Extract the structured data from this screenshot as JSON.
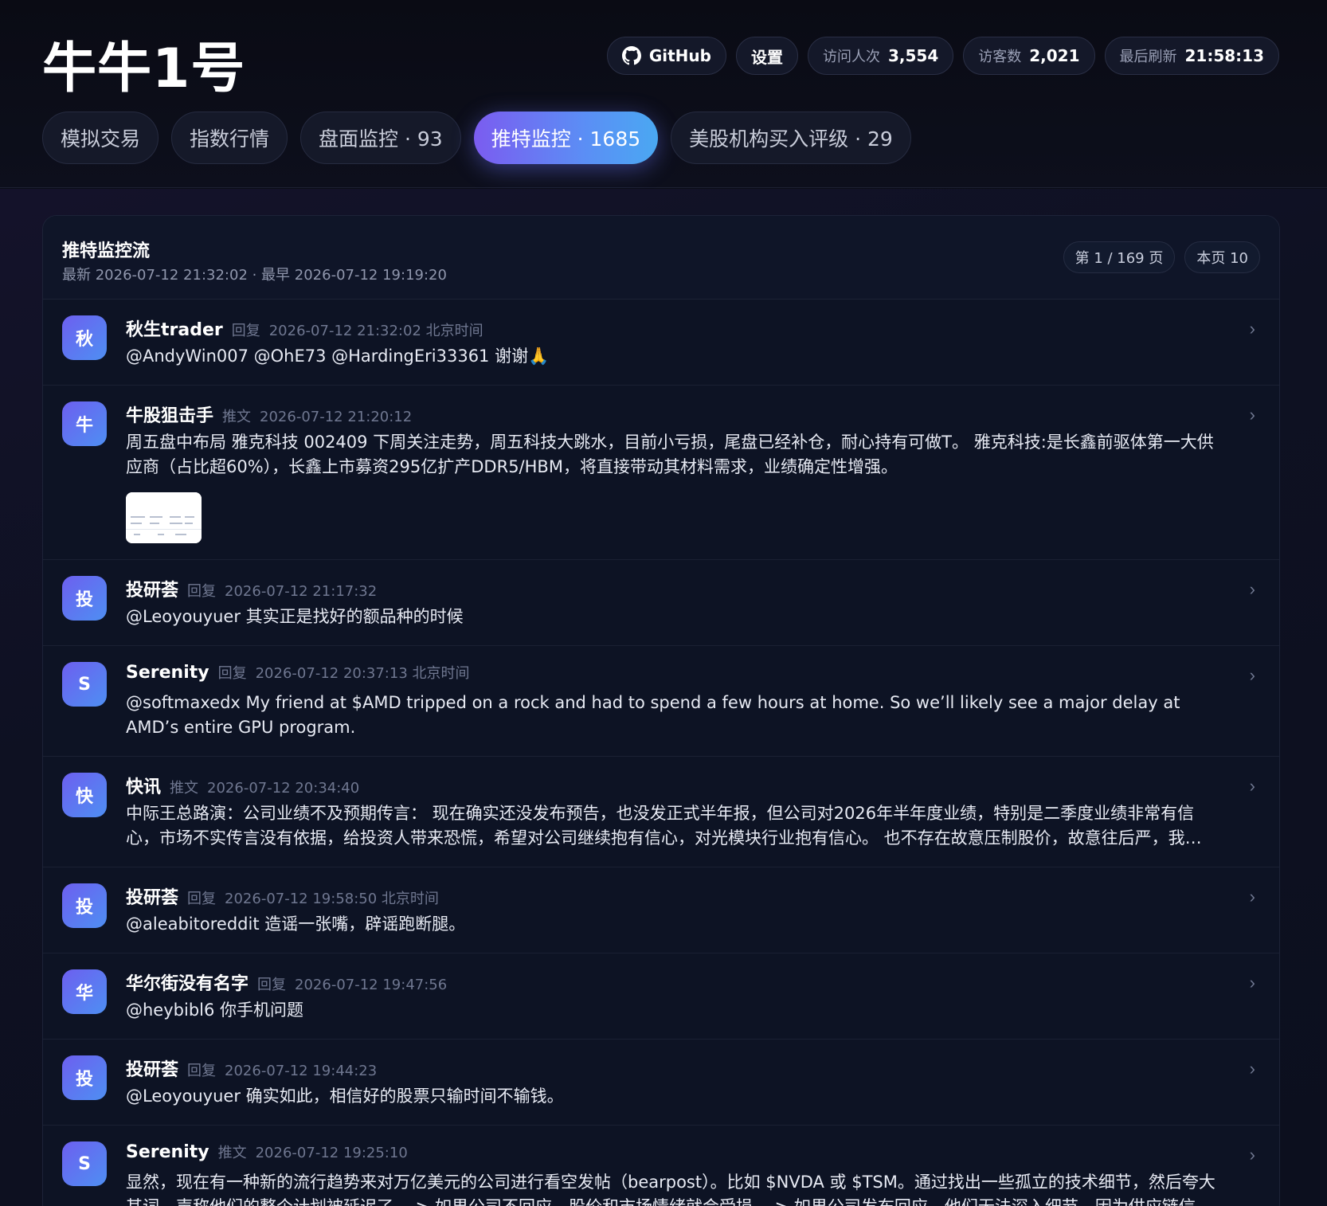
{
  "app": {
    "title": "牛牛1号"
  },
  "header": {
    "github_label": "GitHub",
    "settings_label": "设置",
    "visits_label": "访问人次",
    "visits_value": "3,554",
    "visitors_label": "访客数",
    "visitors_value": "2,021",
    "refresh_label": "最后刷新",
    "refresh_value": "21:58:13"
  },
  "tabs": [
    {
      "label": "模拟交易",
      "active": false
    },
    {
      "label": "指数行情",
      "active": false
    },
    {
      "label": "盘面监控 · 93",
      "active": false
    },
    {
      "label": "推特监控 · 1685",
      "active": true
    },
    {
      "label": "美股机构买入评级 · 29",
      "active": false
    }
  ],
  "panel": {
    "title": "推特监控流",
    "subtitle": "最新 2026-07-12 21:32:02 · 最早 2026-07-12 19:19:20",
    "page_label": "第 1 / 169 页",
    "count_label": "本页 10"
  },
  "feed": [
    {
      "avatar": "秋",
      "author": "秋生trader",
      "kind": "回复",
      "time": "2026-07-12 21:32:02 北京时间",
      "text": "@AndyWin007 @OhE73 @HardingEri33361 谢谢🙏",
      "has_image": false
    },
    {
      "avatar": "牛",
      "author": "牛股狙击手",
      "kind": "推文",
      "time": "2026-07-12 21:20:12",
      "text": "周五盘中布局 雅克科技 002409 下周关注走势，周五科技大跳水，目前小亏损，尾盘已经补仓，耐心持有可做T。 雅克科技:是长鑫前驱体第一大供应商（占比超60%），长鑫上市募资295亿扩产DDR5/HBM，将直接带动其材料需求，业绩确定性增强。",
      "has_image": true
    },
    {
      "avatar": "投",
      "author": "投研荟",
      "kind": "回复",
      "time": "2026-07-12 21:17:32",
      "text": "@Leoyouyuer 其实正是找好的额品种的时候",
      "has_image": false
    },
    {
      "avatar": "S",
      "author": "Serenity",
      "kind": "回复",
      "time": "2026-07-12 20:37:13 北京时间",
      "text": "@softmaxedx My friend at $AMD tripped on a rock and had to spend a few hours at home. So we’ll likely see a major delay at AMD’s entire GPU program.",
      "has_image": false
    },
    {
      "avatar": "快",
      "author": "快讯",
      "kind": "推文",
      "time": "2026-07-12 20:34:40",
      "text": "中际王总路演：公司业绩不及预期传言： 现在确实还没发布预告，也没发正式半年报，但公司对2026年半年度业绩，特别是二季度业绩非常有信心，市场不实传言没有依据，给投资人带来恐慌，希望对公司继续抱有信心，对光模块行业抱有信心。 也不存在故意压制股价，故意往后严，我们在业...",
      "has_image": false
    },
    {
      "avatar": "投",
      "author": "投研荟",
      "kind": "回复",
      "time": "2026-07-12 19:58:50 北京时间",
      "text": "@aleabitoreddit 造谣一张嘴，辟谣跑断腿。",
      "has_image": false
    },
    {
      "avatar": "华",
      "author": "华尔街没有名字",
      "kind": "回复",
      "time": "2026-07-12 19:47:56",
      "text": "@heybibl6 你手机问题",
      "has_image": false
    },
    {
      "avatar": "投",
      "author": "投研荟",
      "kind": "回复",
      "time": "2026-07-12 19:44:23",
      "text": "@Leoyouyuer 确实如此，相信好的股票只输时间不输钱。",
      "has_image": false
    },
    {
      "avatar": "S",
      "author": "Serenity",
      "kind": "推文",
      "time": "2026-07-12 19:25:10",
      "text": "显然，现在有一种新的流行趋势来对万亿美元的公司进行看空发帖（bearpost）。比如 $NVDA 或 $TSM。通过找出一些孤立的技术细节，然后夸大其词，声称他们的整个计划被延迟了。 > 如果公司不回应，股价和市场情绪就会受损。 > 如果公司发布回应，他们无法深入细节，因为供应链信息是...",
      "has_image": false
    }
  ],
  "icons": {
    "github": "github-icon",
    "chevron": "chevron-right-icon"
  },
  "colors": {
    "accent_start": "#7b5cf0",
    "accent_end": "#4aa8f2",
    "background": "#0b0d17"
  }
}
